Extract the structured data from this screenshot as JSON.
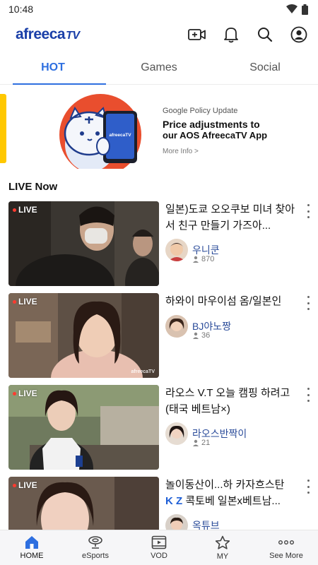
{
  "status_bar": {
    "time": "10:48"
  },
  "header": {
    "logo_main": "afreeca",
    "logo_tv": "TV"
  },
  "tabs": [
    {
      "label": "HOT",
      "active": true
    },
    {
      "label": "Games",
      "active": false
    },
    {
      "label": "Social",
      "active": false
    }
  ],
  "banner": {
    "eyebrow": "Google Policy Update",
    "title_line1": "Price adjustments to",
    "title_line2": "our AOS AfreecaTV App",
    "more": "More Info >",
    "phone_brand": "afreecaTV"
  },
  "section": {
    "title": "LIVE Now"
  },
  "live_items": [
    {
      "badge": "LIVE",
      "title": "일본)도쿄 오오쿠보 미녀 찾아서 친구 만들기 가즈아...",
      "channel": "우니쿤",
      "viewers": "870"
    },
    {
      "badge": "LIVE",
      "title": "하와이 마우이섬 옴/일본인",
      "channel": "BJ야노짱",
      "viewers": "36"
    },
    {
      "badge": "LIVE",
      "title": "라오스 V.T 오늘 캠핑 하려고 (태국 베트남×)",
      "channel": "라오스반짝이",
      "viewers": "21"
    },
    {
      "badge": "LIVE",
      "title_prefix": "놀이동산이...하 카자흐스탄",
      "title_kz": "K Z",
      "title_suffix": "콕토베 일본x베트남...",
      "channel": "옥튜브",
      "viewers": ""
    }
  ],
  "watermark": "afreecaTV",
  "bottom_nav": [
    {
      "label": "HOME",
      "icon": "home-icon",
      "active": true
    },
    {
      "label": "eSports",
      "icon": "trophy-icon",
      "active": false
    },
    {
      "label": "VOD",
      "icon": "vod-icon",
      "active": false
    },
    {
      "label": "MY",
      "icon": "star-icon",
      "active": false
    },
    {
      "label": "See More",
      "icon": "more-icon",
      "active": false
    }
  ],
  "colors": {
    "accent": "#2e6fe0",
    "logo": "#1a3fa8",
    "banner_accent": "#ffc800",
    "live_dot": "#ff3b30"
  }
}
